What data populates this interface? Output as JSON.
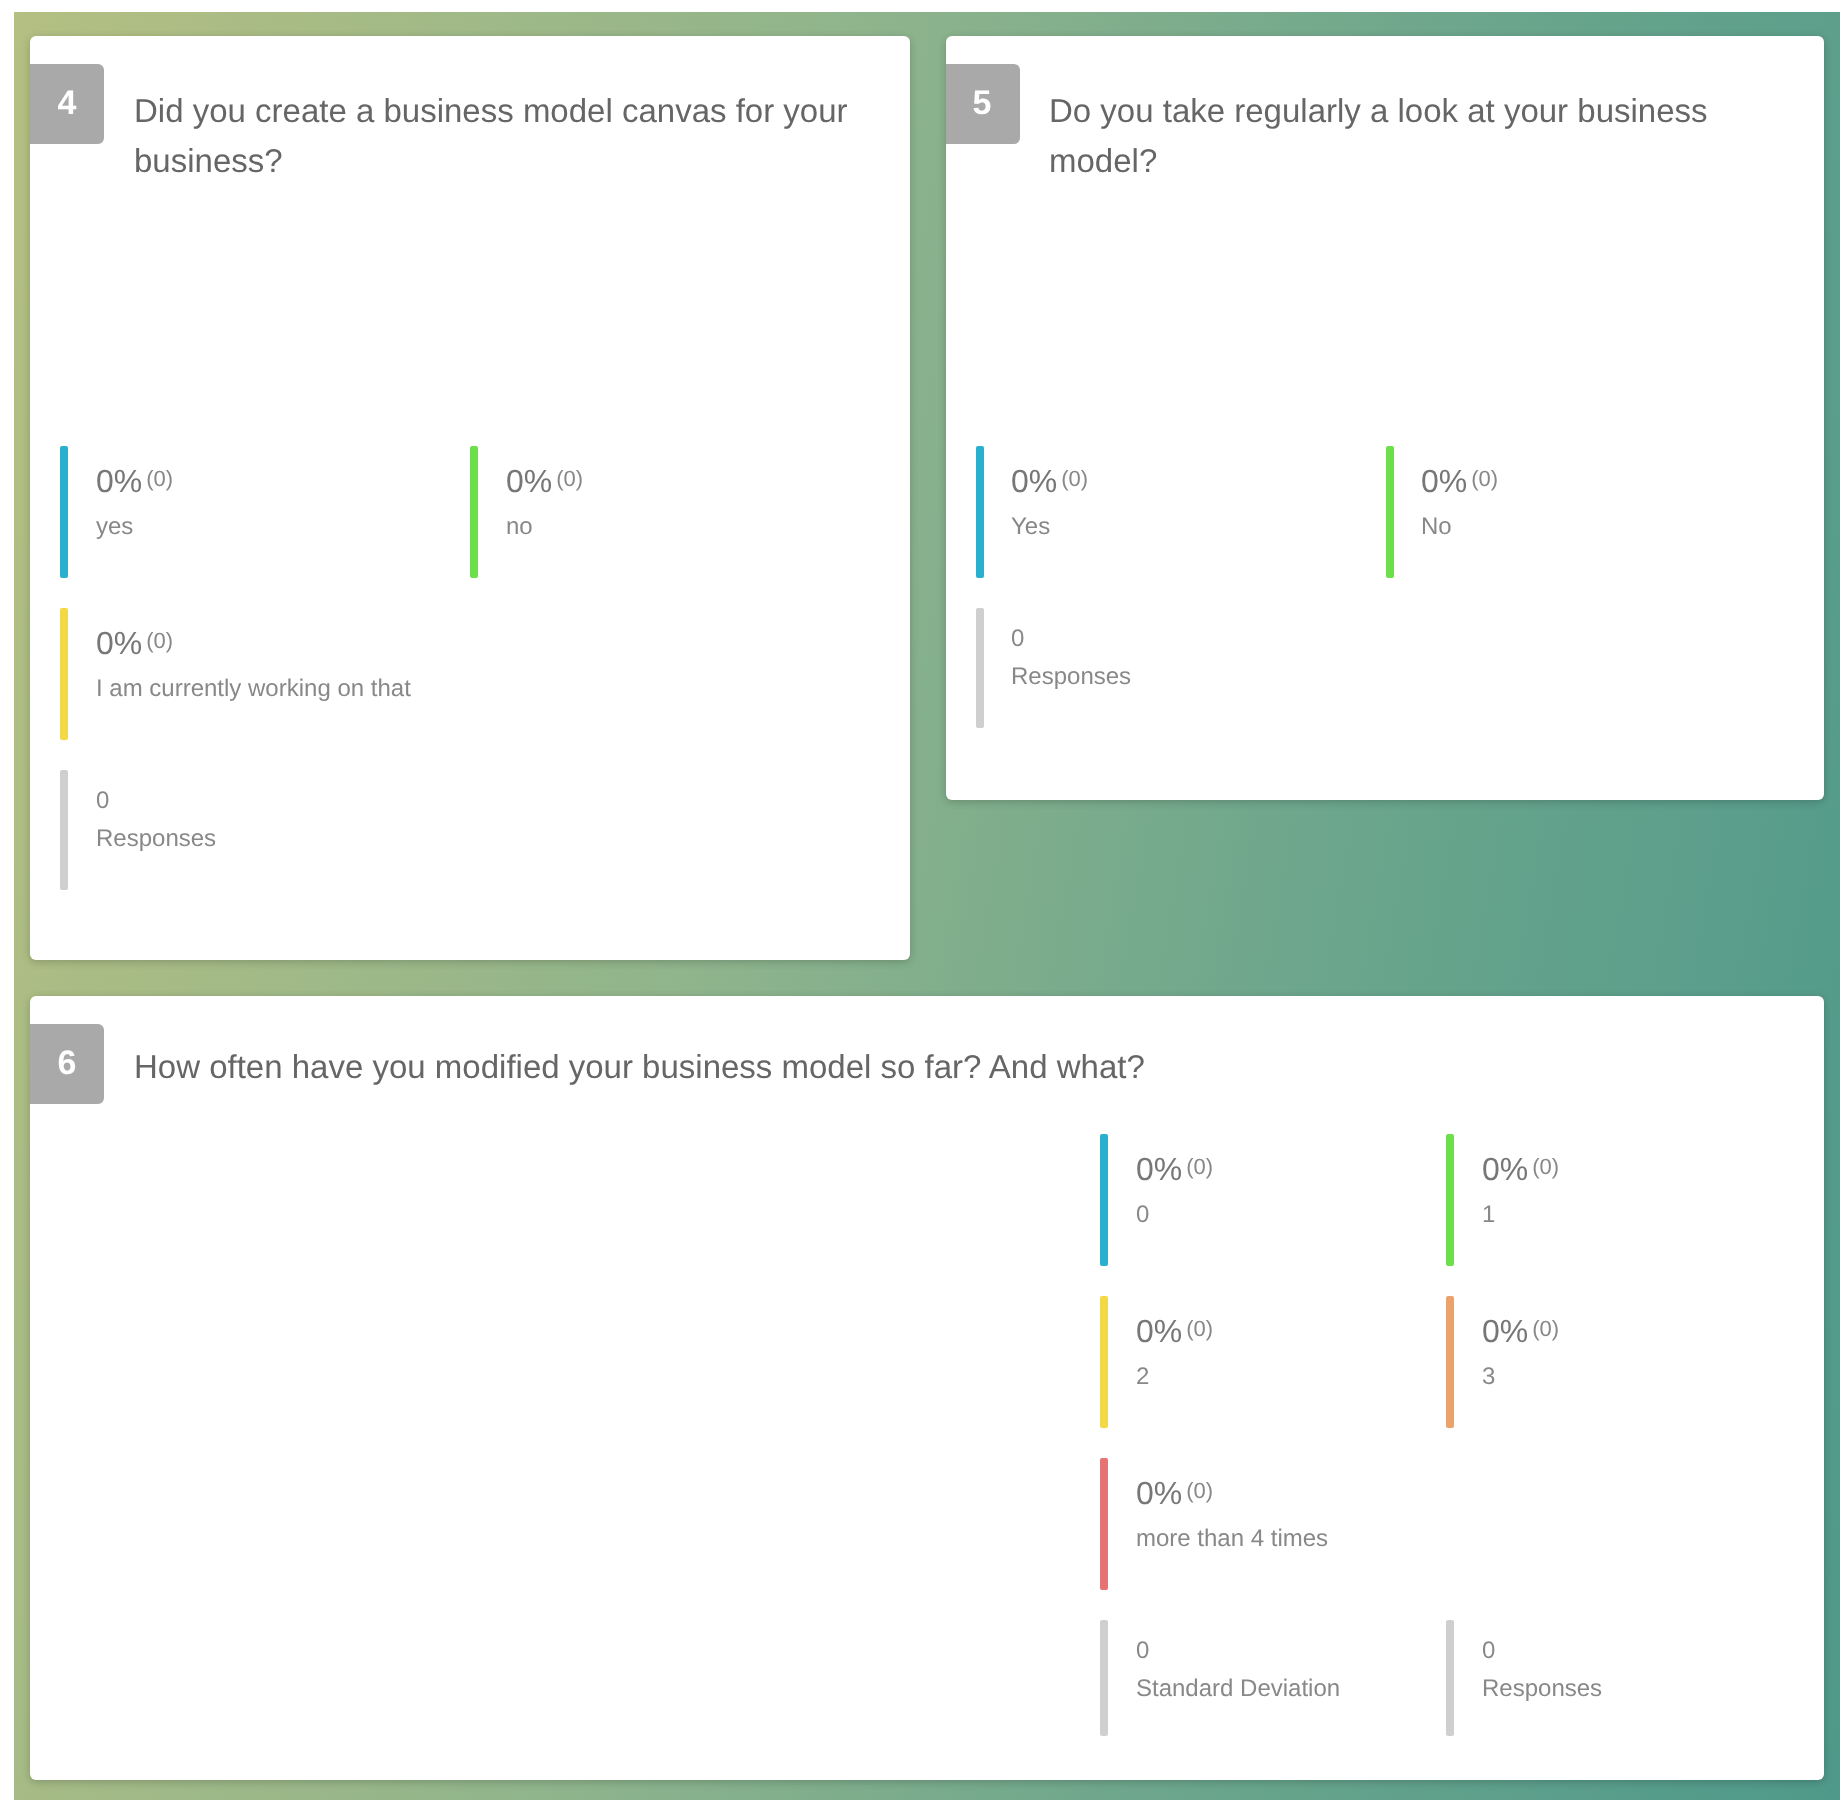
{
  "questions": [
    {
      "number": "4",
      "question": "Did you create a business model canvas for your business?",
      "kind": "half",
      "stats": [
        {
          "kind": "option",
          "value": "0%",
          "count": "(0)",
          "label": "yes",
          "color": "#29b0cf"
        },
        {
          "kind": "option",
          "value": "0%",
          "count": "(0)",
          "label": "no",
          "color": "#6ddf4a"
        },
        {
          "kind": "option",
          "value": "0%",
          "count": "(0)",
          "label": "I am currently working on that",
          "color": "#f5d845"
        },
        {
          "kind": "summary",
          "value": "0",
          "label": "Responses"
        }
      ]
    },
    {
      "number": "5",
      "question": "Do you take regularly a look at your business model?",
      "kind": "half",
      "stats": [
        {
          "kind": "option",
          "value": "0%",
          "count": "(0)",
          "label": "Yes",
          "color": "#29b0cf"
        },
        {
          "kind": "option",
          "value": "0%",
          "count": "(0)",
          "label": "No",
          "color": "#6ddf4a"
        },
        {
          "kind": "summary",
          "value": "0",
          "label": "Responses"
        }
      ]
    },
    {
      "number": "6",
      "question": "How often have you modified your business model so far? And what?",
      "kind": "wide",
      "stats": [
        {
          "kind": "option",
          "value": "0%",
          "count": "(0)",
          "label": "0",
          "color": "#29b0cf"
        },
        {
          "kind": "option",
          "value": "0%",
          "count": "(0)",
          "label": "1",
          "color": "#6ddf4a"
        },
        {
          "kind": "option",
          "value": "0%",
          "count": "(0)",
          "label": "2",
          "color": "#f5d845"
        },
        {
          "kind": "option",
          "value": "0%",
          "count": "(0)",
          "label": "3",
          "color": "#eba36b"
        },
        {
          "kind": "option",
          "value": "0%",
          "count": "(0)",
          "label": "more than 4 times",
          "color": "#e67373"
        },
        {
          "kind": "summary",
          "value": "0",
          "label": "Standard Deviation"
        },
        {
          "kind": "summary",
          "value": "0",
          "label": "Responses"
        }
      ]
    }
  ]
}
